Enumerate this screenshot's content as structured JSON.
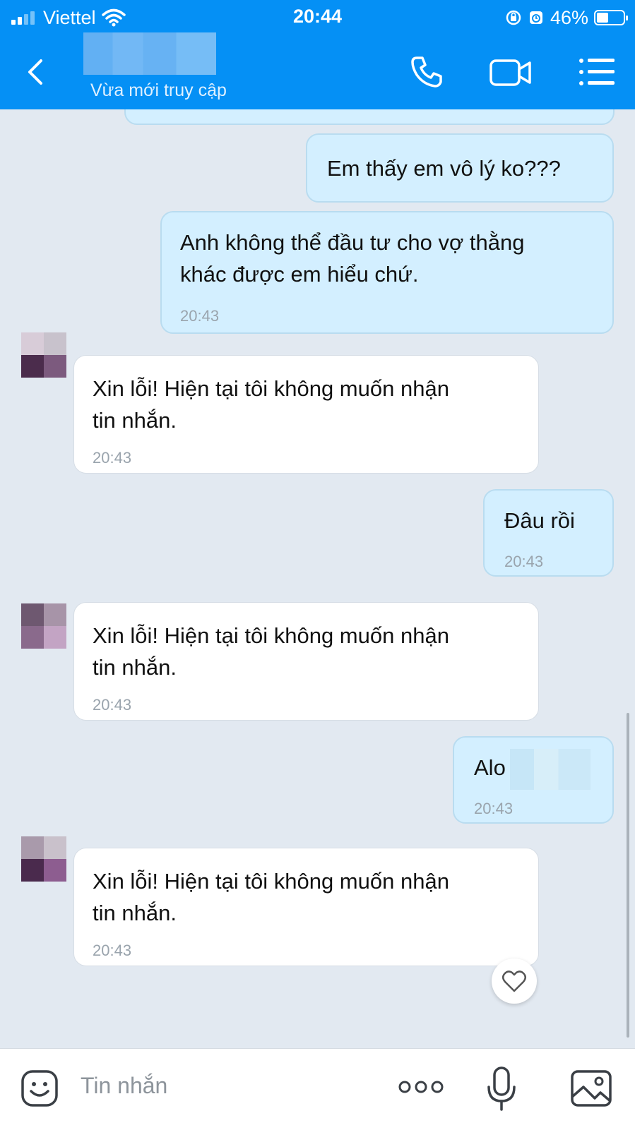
{
  "status_bar": {
    "carrier": "Viettel",
    "time": "20:44",
    "battery": "46%"
  },
  "header": {
    "subtitle": "Vừa mới truy cập"
  },
  "messages": [
    {
      "type": "sent",
      "text": "Em thấy em vô lý ko???"
    },
    {
      "type": "sent",
      "text": "Anh không thể đầu tư cho vợ thằng\nkhác được em hiểu chứ.",
      "time": "20:43"
    },
    {
      "type": "received",
      "text": "Xin lỗi! Hiện tại tôi không muốn nhận\ntin nhắn.",
      "time": "20:43"
    },
    {
      "type": "sent",
      "text": "Đâu rồi",
      "time": "20:43"
    },
    {
      "type": "received",
      "text": "Xin lỗi! Hiện tại tôi không muốn nhận\ntin nhắn.",
      "time": "20:43"
    },
    {
      "type": "sent",
      "text": "Alo",
      "time": "20:43"
    },
    {
      "type": "received",
      "text": "Xin lỗi! Hiện tại tôi không muốn nhận\ntin nhắn.",
      "time": "20:43"
    }
  ],
  "input": {
    "placeholder": "Tin nhắn"
  },
  "icons": {
    "back": "chevron-left-icon",
    "call": "phone-icon",
    "video": "video-camera-icon",
    "menu": "list-menu-icon",
    "emoji": "emoji-icon",
    "more": "more-dots-icon",
    "mic": "microphone-icon",
    "image": "image-icon",
    "react": "heart-icon"
  },
  "colors": {
    "header": "#0590f5",
    "background": "#e2e9f1",
    "sent_bubble": "#d3efff",
    "received_bubble": "#ffffff"
  }
}
